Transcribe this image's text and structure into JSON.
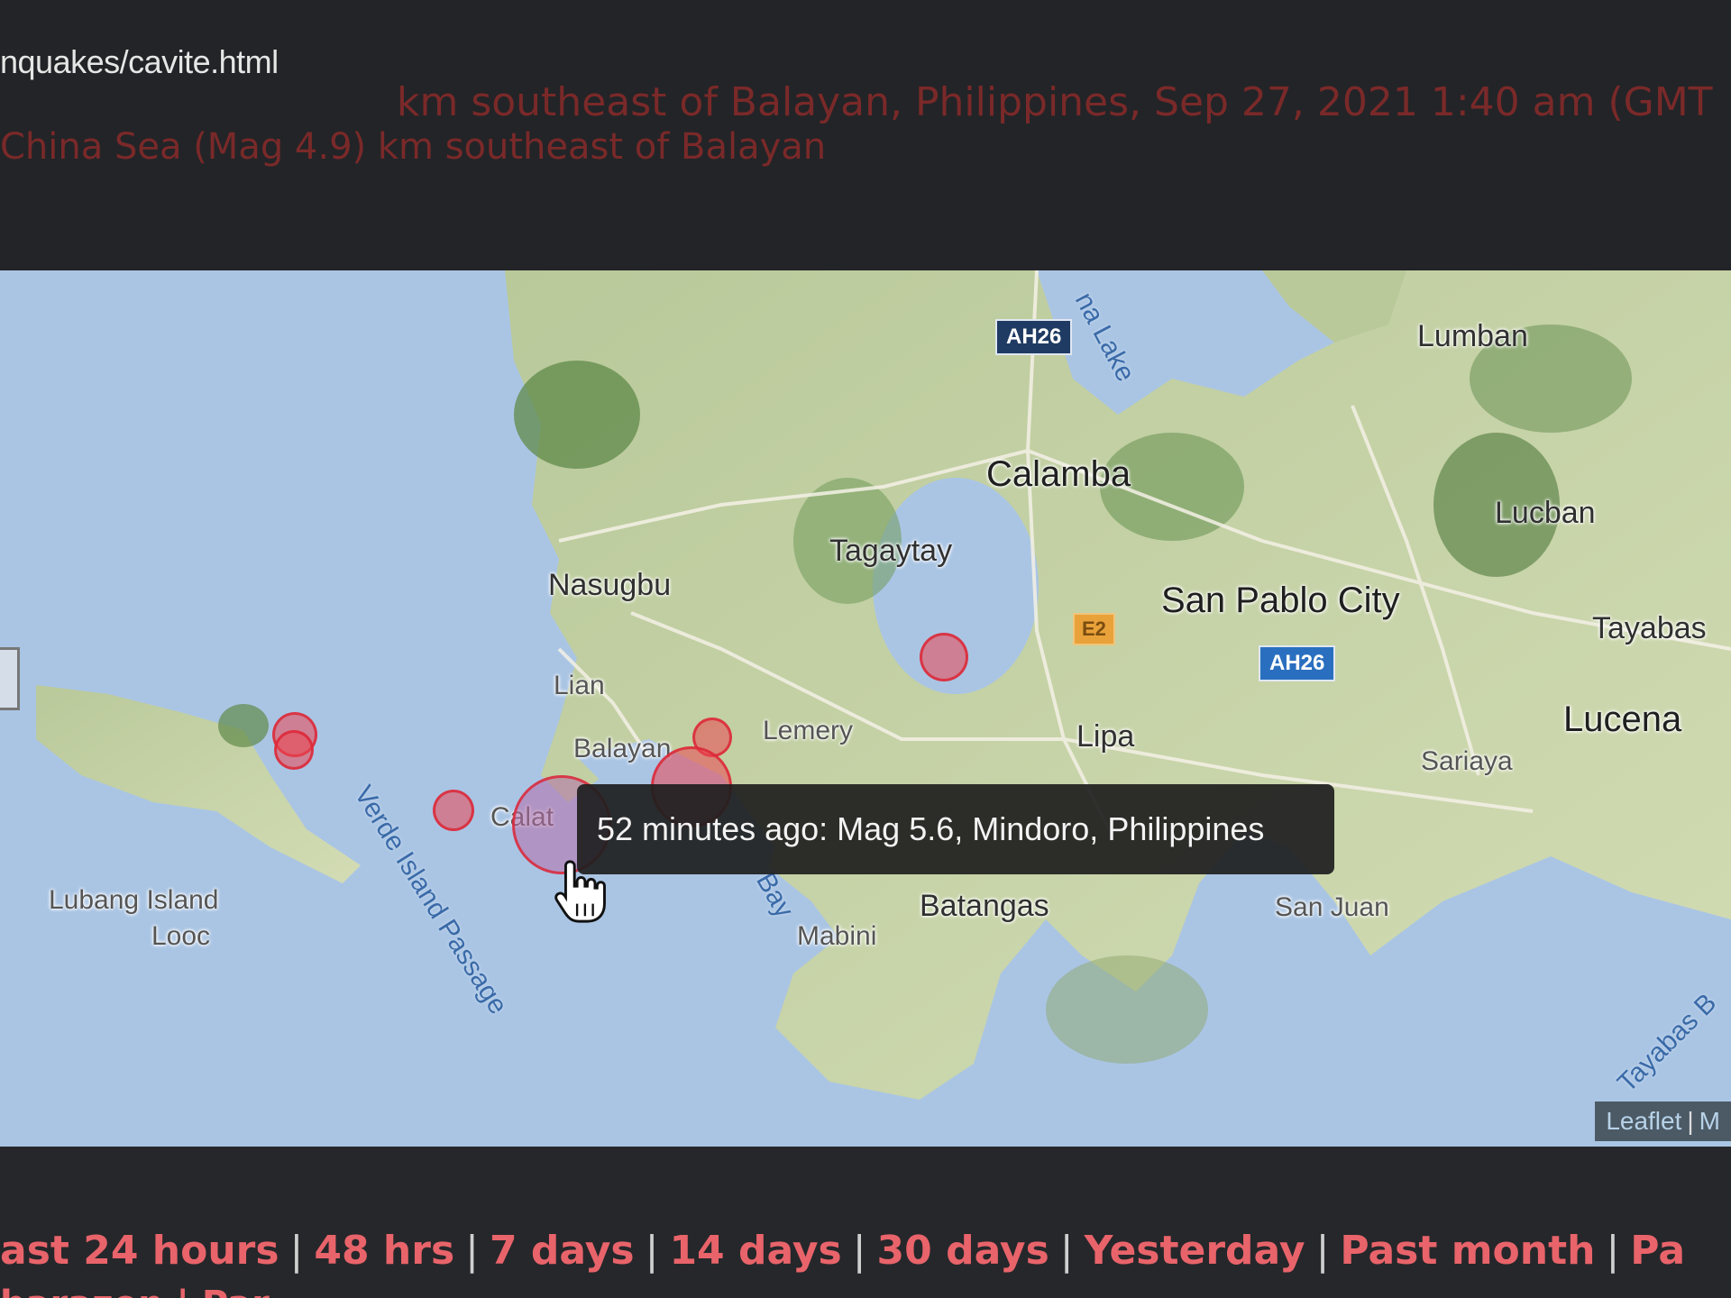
{
  "header": {
    "url": "nquakes/cavite.html",
    "quake_line_1": "km southeast of Balayan, Philippines, Sep 27, 2021 1:40 am (GMT",
    "quake_line_2": "China Sea (Mag 4.9) km southeast of Balayan"
  },
  "map": {
    "places": {
      "calamba": "Calamba",
      "tagaytay": "Tagaytay",
      "nasugbu": "Nasugbu",
      "lian": "Lian",
      "balayan": "Balayan",
      "lemery": "Lemery",
      "lipa": "Lipa",
      "san_pablo": "San Pablo City",
      "lumban": "Lumban",
      "lucban": "Lucban",
      "tayabas": "Tayabas",
      "lucena": "Lucena",
      "sariaya": "Sariaya",
      "batangas": "Batangas",
      "san_juan": "San Juan",
      "mabini": "Mabini",
      "lubang": "Lubang Island",
      "looc": "Looc",
      "calatagan": "Calat"
    },
    "water": {
      "lake": "na Lake",
      "verde": "Verde Island Passage",
      "bay": "Bay",
      "tayabas_bay": "Tayabas B"
    },
    "roads": {
      "ah26_top": "AH26",
      "ah26_mid": "AH26",
      "e2": "E2"
    },
    "tooltip": "52 minutes ago: Mag 5.6, Mindoro, Philippines",
    "attribution": {
      "leaflet": "Leaflet",
      "sep": "|",
      "rest": "M"
    }
  },
  "nav": {
    "items": [
      "ast 24 hours",
      "48 hrs",
      "7 days",
      "14 days",
      "30 days",
      "Yesterday",
      "Past month",
      "Pa"
    ],
    "separator": "|",
    "second_line": "harazon | Par"
  },
  "colors": {
    "quake_fill": "#eb4650",
    "nav_link": "#e8646a",
    "water": "#a9c6e6",
    "land": "#c9d6a6"
  }
}
